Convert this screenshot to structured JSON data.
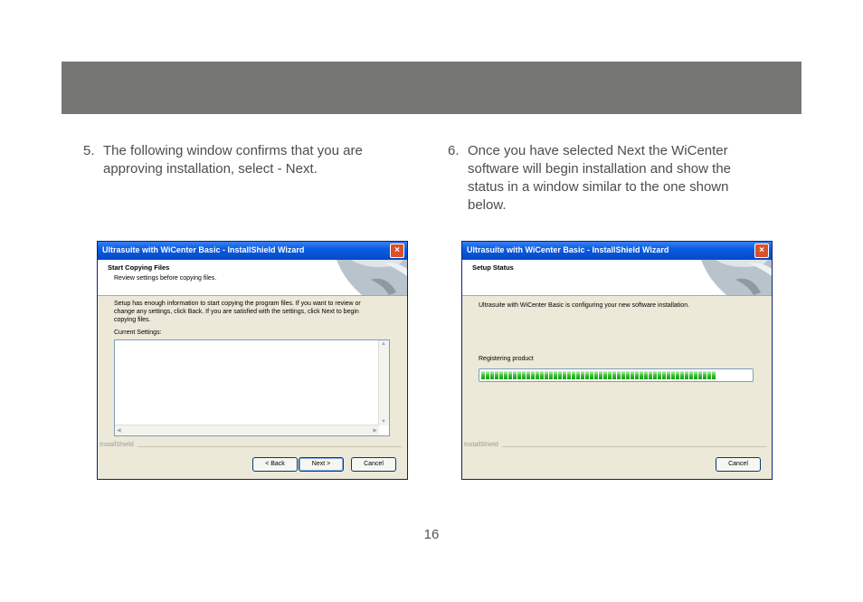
{
  "steps": [
    {
      "number": "5.",
      "lines": [
        "The following window confirms that you are",
        "approving installation, select - Next."
      ]
    },
    {
      "number": "6.",
      "lines": [
        "Once you have selected Next the WiCenter",
        "software will begin installation and show the",
        "status in a window similar to the one shown",
        "below."
      ]
    }
  ],
  "page_number": "16",
  "dialog1": {
    "title": "Ultrasuite with WiCenter Basic - InstallShield Wizard",
    "close_glyph": "×",
    "header_title": "Start Copying Files",
    "header_sub": "Review settings before copying files.",
    "body_lines": [
      "Setup has enough information to start copying the program files.  If you want to review or",
      "change any settings, click Back.  If you are satisfied with the settings, click Next to begin",
      "copying files."
    ],
    "current_settings_label": "Current Settings:",
    "current_settings_value": "",
    "brand": "InstallShield",
    "buttons": {
      "back": "< Back",
      "next": "Next >",
      "cancel": "Cancel"
    }
  },
  "dialog2": {
    "title": "Ultrasuite with WiCenter Basic - InstallShield Wizard",
    "close_glyph": "×",
    "header_title": "Setup Status",
    "body_line": "Ultrasuite with WiCenter Basic is configuring your new software installation.",
    "status_label": "Registering product",
    "progress_fraction": 0.88,
    "brand": "InstallShield",
    "buttons": {
      "cancel": "Cancel"
    }
  },
  "colors": {
    "header_band": "#767775",
    "titlebar": "#0548c9",
    "dialog_bg": "#ece9d8",
    "progress": "#2fbf2b"
  }
}
